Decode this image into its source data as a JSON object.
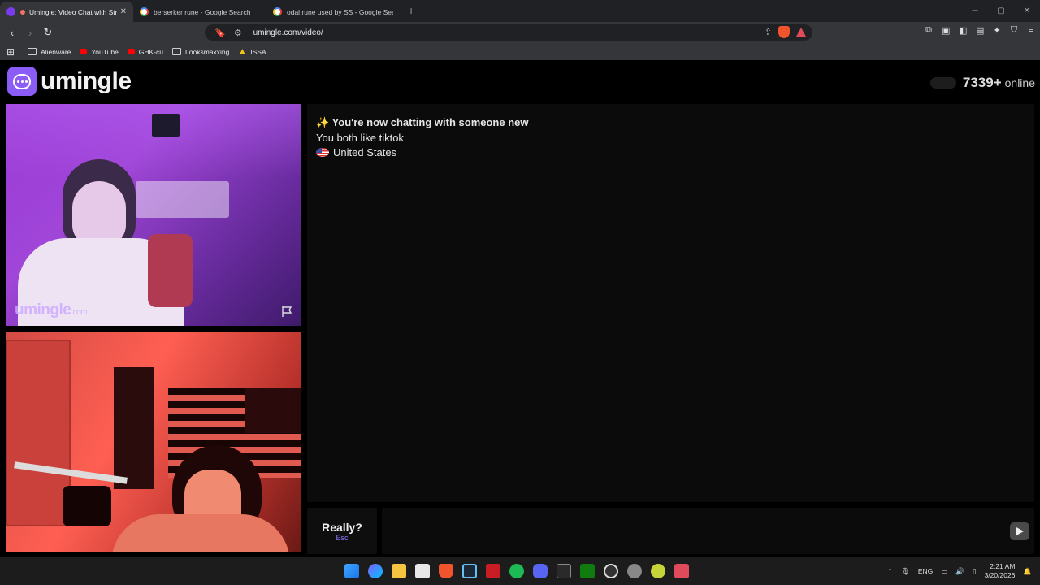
{
  "browser": {
    "tabs": [
      {
        "title": "Umingle: Video Chat with Str",
        "active": true
      },
      {
        "title": "berserker rune - Google Search",
        "active": false
      },
      {
        "title": "odal rune used by SS - Google Search",
        "active": false
      }
    ],
    "new_tab": "+",
    "url": "umingle.com/video/",
    "bookmarks": [
      "Alienware",
      "YouTube",
      "GHK-cu",
      "Looksmaxxing",
      "ISSA"
    ]
  },
  "header": {
    "logo_text": "umingle",
    "online_count": "7339+",
    "online_label": "online"
  },
  "video": {
    "watermark": "umingle",
    "watermark_suffix": ".com"
  },
  "chat": {
    "intro": "✨ You're now chatting with someone new",
    "common": "You both like tiktok",
    "country": "United States"
  },
  "composer": {
    "skip_label": "Really?",
    "skip_hint": "Esc",
    "input_value": ""
  },
  "taskbar": {
    "lang": "ENG",
    "time": "2:21 AM",
    "date": "3/20/2026"
  },
  "colors": {
    "brand": "#8b5cf6",
    "accent_hint": "#8b7bff"
  }
}
